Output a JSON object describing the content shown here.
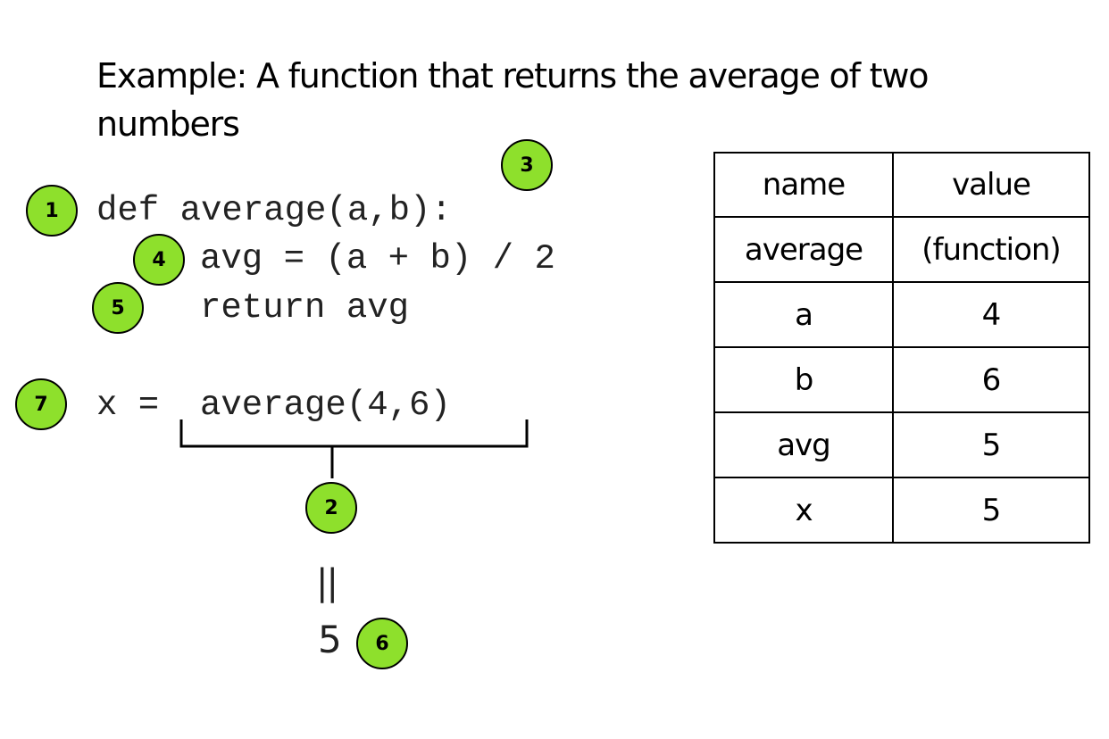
{
  "title": "Example: A function that returns the average of two numbers",
  "code": {
    "line1": "def average(a,b):",
    "line2": "avg = (a + b) / 2",
    "line3": "return avg",
    "line4_prefix": "x = ",
    "line4_call": "average(4,6)"
  },
  "result": {
    "equals_sign": "||",
    "value": "5"
  },
  "badges": [
    "1",
    "2",
    "3",
    "4",
    "5",
    "6",
    "7"
  ],
  "badge_color": "#8ee02c",
  "table": {
    "headers": [
      "name",
      "value"
    ],
    "rows": [
      [
        "average",
        "(function)"
      ],
      [
        "a",
        "4"
      ],
      [
        "b",
        "6"
      ],
      [
        "avg",
        "5"
      ],
      [
        "x",
        "5"
      ]
    ]
  }
}
